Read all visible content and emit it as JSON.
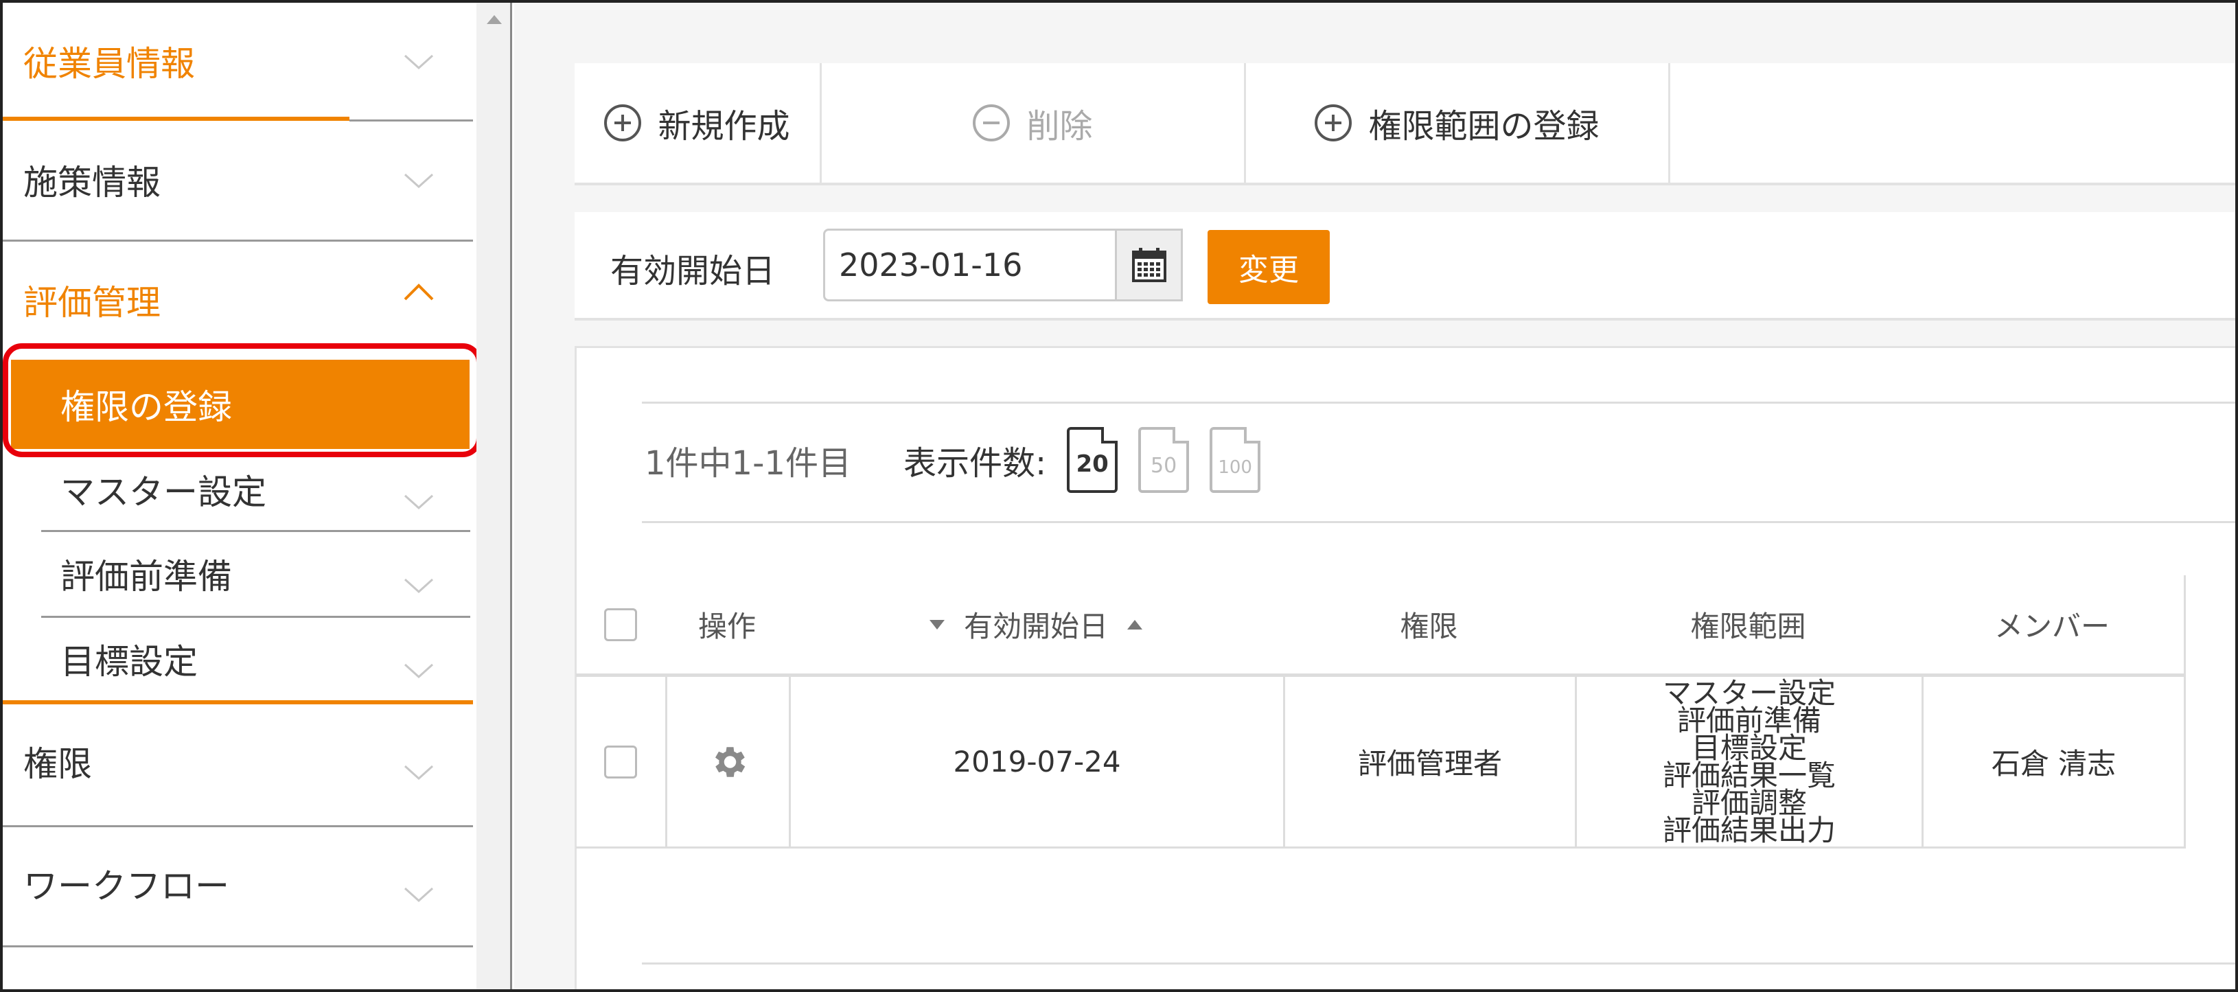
{
  "sidebar": {
    "items": [
      {
        "label": "従業員情報"
      },
      {
        "label": "施策情報"
      },
      {
        "label": "評価管理"
      },
      {
        "label": "権限の登録"
      },
      {
        "label": "マスター設定"
      },
      {
        "label": "評価前準備"
      },
      {
        "label": "目標設定"
      },
      {
        "label": "権限"
      },
      {
        "label": "ワークフロー"
      }
    ]
  },
  "toolbar": {
    "new_label": "新規作成",
    "delete_label": "削除",
    "scope_label": "権限範囲の登録"
  },
  "filter": {
    "label": "有効開始日",
    "date_value": "2023-01-16",
    "change_label": "変更"
  },
  "pager": {
    "count_text": "1件中1-1件目",
    "display_label": "表示件数:",
    "sizes": [
      "20",
      "50",
      "100"
    ],
    "selected_size": "20"
  },
  "table": {
    "headers": {
      "action": "操作",
      "start_date": "有効開始日",
      "role": "権限",
      "scope": "権限範囲",
      "member": "メンバー"
    },
    "rows": [
      {
        "start_date": "2019-07-24",
        "role": "評価管理者",
        "scope": [
          "マスター設定",
          "評価前準備",
          "目標設定",
          "評価結果一覧",
          "評価調整",
          "評価結果出力"
        ],
        "member": "石倉 清志"
      }
    ]
  },
  "colors": {
    "accent": "#f08300",
    "highlight_outline": "#e8000b"
  }
}
